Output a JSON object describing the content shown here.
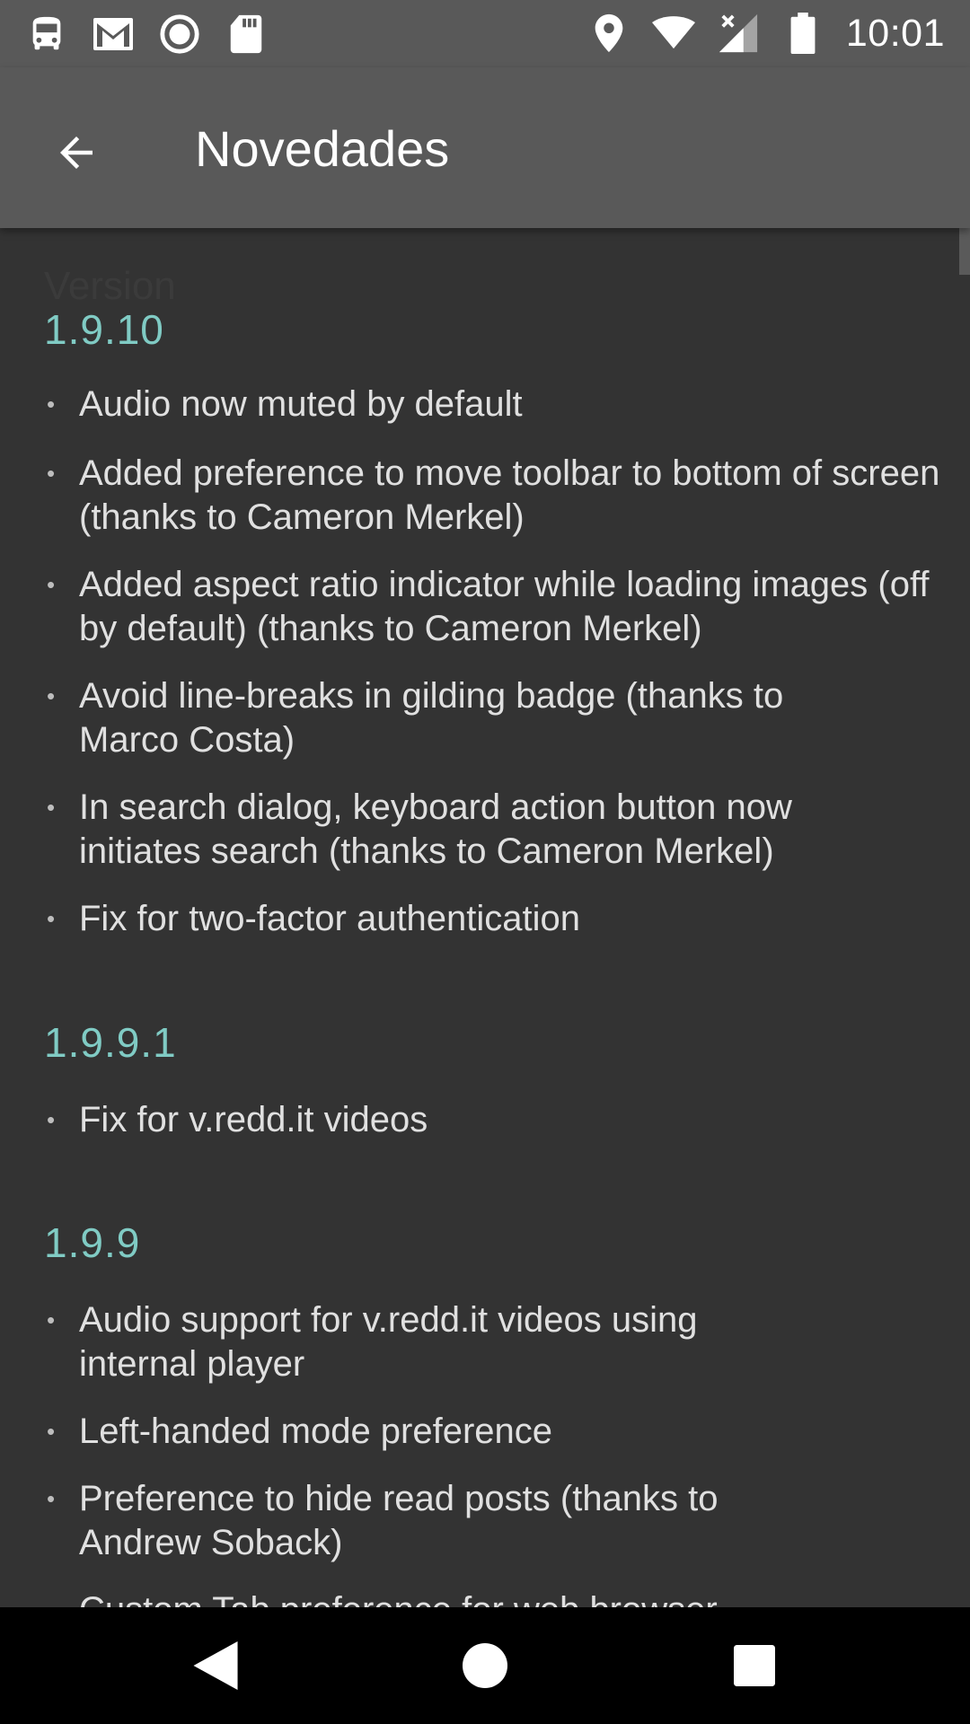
{
  "status": {
    "time": "10:01",
    "left_icons": [
      "bus-icon",
      "gmail-icon",
      "record-icon",
      "sd-card-icon"
    ],
    "right_icons": [
      "location-icon",
      "wifi-icon",
      "signal-icon",
      "battery-icon"
    ]
  },
  "appbar": {
    "title": "Novedades"
  },
  "content": {
    "faded_label": "Version",
    "sections": [
      {
        "version": "1.9.10",
        "items": [
          "Audio now muted by default",
          "Added preference to move toolbar to bottom of screen (thanks to Cameron Merkel)",
          "Added aspect ratio indicator while loading images (off by default) (thanks to Cameron Merkel)",
          "Avoid line-breaks in gilding badge (thanks to Marco Costa)",
          "In search dialog, keyboard action button now initiates search (thanks to Cameron Merkel)",
          "Fix for two-factor authentication"
        ]
      },
      {
        "version": "1.9.9.1",
        "items": [
          "Fix for v.redd.it videos"
        ]
      },
      {
        "version": "1.9.9",
        "items": [
          "Audio support for v.redd.it videos using internal player",
          "Left-handed mode preference",
          "Preference to hide read posts (thanks to Andrew Soback)",
          "Custom Tab preference for web browser"
        ]
      }
    ]
  },
  "colors": {
    "background": "#333333",
    "appbar": "#595959",
    "version_accent": "#80cbc4",
    "body_text": "#e0e0e0"
  }
}
